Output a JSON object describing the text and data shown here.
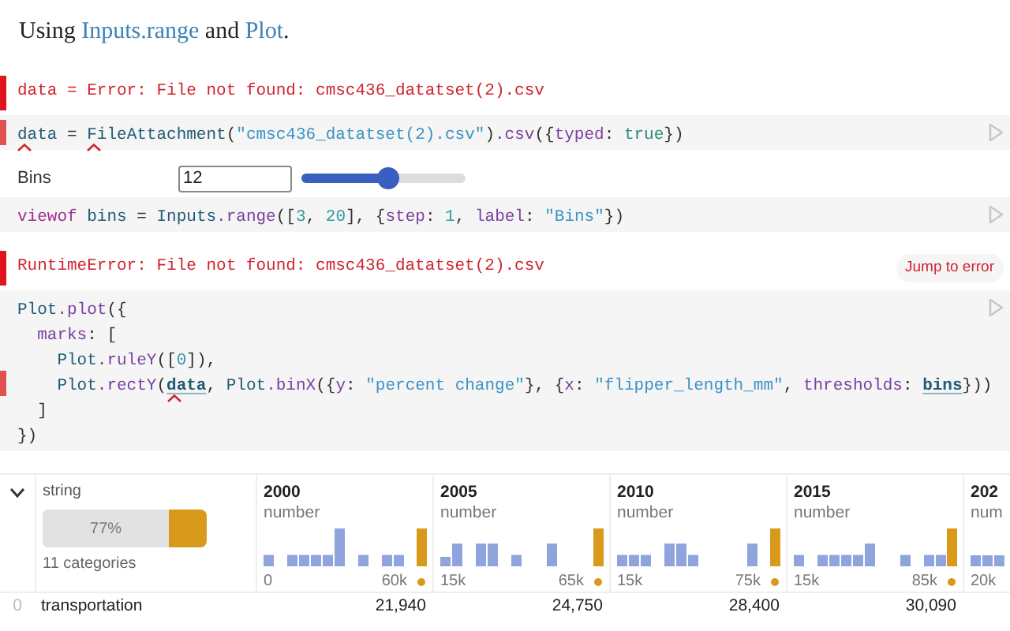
{
  "intro": [
    {
      "text": "Using ",
      "kind": "plain"
    },
    {
      "text": "Inputs.range",
      "kind": "link"
    },
    {
      "text": " and ",
      "kind": "plain"
    },
    {
      "text": "Plot",
      "kind": "link"
    },
    {
      "text": ".",
      "kind": "plain"
    }
  ],
  "cells": [
    {
      "kind": "error",
      "message": "data = Error: File not found: cmsc436_datatset(2).csv"
    },
    {
      "kind": "code",
      "lines": [
        {
          "failed": true,
          "tokens": [
            {
              "text": "data",
              "kind": "name",
              "flag": true
            },
            {
              "text": " = ",
              "kind": "plain"
            },
            {
              "text": "FileAttachment",
              "kind": "name",
              "flag": true
            },
            {
              "text": "(",
              "kind": "plain"
            },
            {
              "text": "\"cmsc436_datatset(2).csv\"",
              "kind": "string"
            },
            {
              "text": ")",
              "kind": "plain"
            },
            {
              "text": ".csv",
              "kind": "prop"
            },
            {
              "text": "({",
              "kind": "plain"
            },
            {
              "text": "typed",
              "kind": "prop"
            },
            {
              "text": ": ",
              "kind": "plain"
            },
            {
              "text": "true",
              "kind": "literal"
            },
            {
              "text": "})",
              "kind": "plain"
            }
          ]
        }
      ]
    },
    {
      "kind": "input",
      "label": "Bins",
      "value": "12",
      "level": 0.53
    },
    {
      "kind": "code",
      "lines": [
        {
          "failed": false,
          "tokens": [
            {
              "text": "viewof ",
              "kind": "keyword"
            },
            {
              "text": "bins",
              "kind": "name"
            },
            {
              "text": " = ",
              "kind": "plain"
            },
            {
              "text": "Inputs",
              "kind": "name"
            },
            {
              "text": ".range",
              "kind": "prop"
            },
            {
              "text": "([",
              "kind": "plain"
            },
            {
              "text": "3",
              "kind": "number"
            },
            {
              "text": ", ",
              "kind": "plain"
            },
            {
              "text": "20",
              "kind": "number"
            },
            {
              "text": "], {",
              "kind": "plain"
            },
            {
              "text": "step",
              "kind": "prop"
            },
            {
              "text": ": ",
              "kind": "plain"
            },
            {
              "text": "1",
              "kind": "number"
            },
            {
              "text": ", ",
              "kind": "plain"
            },
            {
              "text": "label",
              "kind": "prop"
            },
            {
              "text": ": ",
              "kind": "plain"
            },
            {
              "text": "\"Bins\"",
              "kind": "string"
            },
            {
              "text": "})",
              "kind": "plain"
            }
          ]
        }
      ]
    },
    {
      "kind": "error",
      "message": "RuntimeError: File not found: cmsc436_datatset(2).csv",
      "action": "Jump to error"
    },
    {
      "kind": "code",
      "lines": [
        {
          "failed": false,
          "tokens": [
            {
              "text": "Plot",
              "kind": "name"
            },
            {
              "text": ".plot",
              "kind": "prop"
            },
            {
              "text": "({",
              "kind": "plain"
            }
          ],
          "children": [
            {
              "failed": false,
              "tokens": [
                {
                  "text": "marks",
                  "kind": "prop"
                },
                {
                  "text": ": [",
                  "kind": "plain"
                }
              ],
              "children": [
                {
                  "failed": false,
                  "tokens": [
                    {
                      "text": "Plot",
                      "kind": "name"
                    },
                    {
                      "text": ".ruleY",
                      "kind": "prop"
                    },
                    {
                      "text": "([",
                      "kind": "plain"
                    },
                    {
                      "text": "0",
                      "kind": "number"
                    },
                    {
                      "text": "]),",
                      "kind": "plain"
                    }
                  ]
                },
                {
                  "failed": true,
                  "tokens": [
                    {
                      "text": "Plot",
                      "kind": "name"
                    },
                    {
                      "text": ".rectY",
                      "kind": "prop"
                    },
                    {
                      "text": "(",
                      "kind": "plain"
                    },
                    {
                      "text": "data",
                      "kind": "ref",
                      "flag": true
                    },
                    {
                      "text": ", ",
                      "kind": "plain"
                    },
                    {
                      "text": "Plot",
                      "kind": "name"
                    },
                    {
                      "text": ".binX",
                      "kind": "prop"
                    },
                    {
                      "text": "({",
                      "kind": "plain"
                    },
                    {
                      "text": "y",
                      "kind": "prop"
                    },
                    {
                      "text": ": ",
                      "kind": "plain"
                    },
                    {
                      "text": "\"percent change\"",
                      "kind": "string"
                    },
                    {
                      "text": "}, {",
                      "kind": "plain"
                    },
                    {
                      "text": "x",
                      "kind": "prop"
                    },
                    {
                      "text": ": ",
                      "kind": "plain"
                    },
                    {
                      "text": "\"flipper_length_mm\"",
                      "kind": "string"
                    },
                    {
                      "text": ", ",
                      "kind": "plain"
                    },
                    {
                      "text": "thresholds",
                      "kind": "prop"
                    },
                    {
                      "text": ": ",
                      "kind": "plain"
                    },
                    {
                      "text": "bins",
                      "kind": "ref"
                    },
                    {
                      "text": "}))",
                      "kind": "plain"
                    }
                  ]
                }
              ]
            },
            {
              "failed": false,
              "tokens": [
                {
                  "text": "]",
                  "kind": "plain"
                }
              ]
            }
          ]
        },
        {
          "failed": false,
          "tokens": [
            {
              "text": "})",
              "kind": "plain"
            }
          ]
        }
      ]
    }
  ],
  "table": {
    "columns": [
      {
        "kind": "category",
        "type": "string",
        "summary": "77%",
        "level": 0.77,
        "count": "11 categories"
      },
      {
        "kind": "number",
        "name": "2000",
        "type": "number",
        "min": "0",
        "max": "60k"
      },
      {
        "kind": "number",
        "name": "2005",
        "type": "number",
        "min": "15k",
        "max": "65k"
      },
      {
        "kind": "number",
        "name": "2010",
        "type": "number",
        "min": "15k",
        "max": "75k"
      },
      {
        "kind": "number",
        "name": "2015",
        "type": "number",
        "min": "15k",
        "max": "85k"
      },
      {
        "kind": "number",
        "name": "202",
        "type": "num",
        "min": "20k"
      }
    ],
    "rows": [
      {
        "index": "0",
        "cells": [
          "transportation",
          "21,940",
          "24,750",
          "28,400",
          "30,090"
        ]
      }
    ]
  }
}
